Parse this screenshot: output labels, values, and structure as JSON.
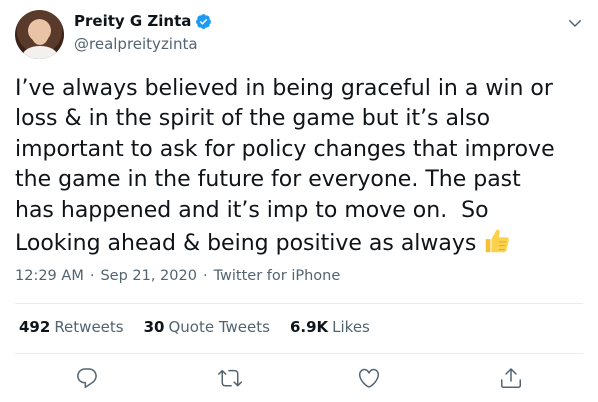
{
  "author": {
    "display_name": "Preity G Zinta",
    "handle": "@realpreityzinta",
    "verified": true
  },
  "tweet": {
    "text": "I’ve always believed in being graceful in a win or\nloss & in the spirit of the game but it’s also\nimportant to ask for policy changes that improve\nthe game in the future for everyone. The past\nhas happened and it’s imp to move on.  So\nLooking ahead & being positive as always",
    "emoji": "thumbs-up"
  },
  "meta": {
    "time": "12:29 AM",
    "separator": "·",
    "date": "Sep 21, 2020",
    "source": "Twitter for iPhone"
  },
  "stats": {
    "retweets_count": "492",
    "retweets_label": "Retweets",
    "quotes_count": "30",
    "quotes_label": "Quote Tweets",
    "likes_count": "6.9K",
    "likes_label": "Likes"
  },
  "colors": {
    "text": "#0f1419",
    "secondary": "#536471",
    "verified": "#1d9bf0",
    "divider": "#e6ecf0"
  },
  "icons": [
    "verified-badge-icon",
    "chevron-down-icon",
    "reply-icon",
    "retweet-icon",
    "like-icon",
    "share-icon"
  ]
}
